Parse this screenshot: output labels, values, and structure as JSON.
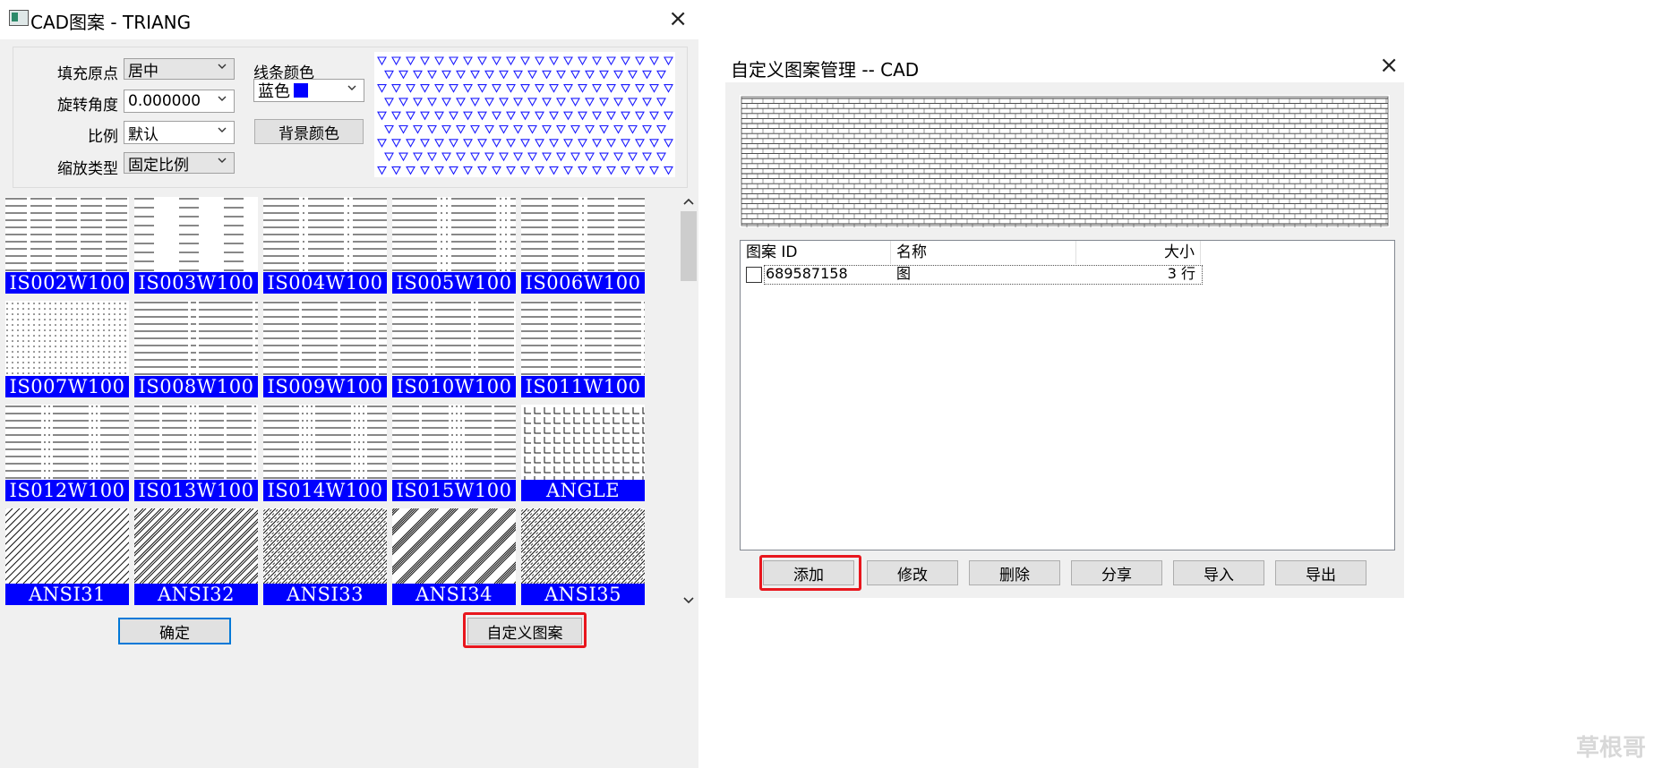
{
  "left_dialog": {
    "title": "CAD图案 - TRIANG",
    "close": "×",
    "fields": {
      "fill_origin_label": "填充原点",
      "fill_origin_value": "居中",
      "rotation_label": "旋转角度",
      "rotation_value": "0.000000",
      "scale_label": "比例",
      "scale_value": "默认",
      "scale_type_label": "缩放类型",
      "scale_type_value": "固定比例",
      "line_color_label": "线条颜色",
      "line_color_value": "蓝色",
      "line_color_swatch": "#0000ff",
      "background_color_button": "背景颜色"
    },
    "patterns": [
      "IS002W100",
      "IS003W100",
      "IS004W100",
      "IS005W100",
      "IS006W100",
      "IS007W100",
      "IS008W100",
      "IS009W100",
      "IS010W100",
      "IS011W100",
      "IS012W100",
      "IS013W100",
      "IS014W100",
      "IS015W100",
      "ANGLE",
      "ANSI31",
      "ANSI32",
      "ANSI33",
      "ANSI34",
      "ANSI35"
    ],
    "ok_button": "确定",
    "custom_pattern_button": "自定义图案"
  },
  "right_dialog": {
    "title": "自定义图案管理 -- CAD",
    "close": "×",
    "table": {
      "columns": [
        "图案 ID",
        "名称",
        "大小"
      ],
      "rows": [
        {
          "id": "689587158",
          "name": "图",
          "size": "3 行"
        }
      ]
    },
    "buttons": {
      "add": "添加",
      "modify": "修改",
      "delete": "删除",
      "share": "分享",
      "import": "导入",
      "export": "导出"
    }
  },
  "watermark": "草根哥",
  "colors": {
    "pattern_label_bg": "#0000ff",
    "highlight_red": "#e8161d",
    "preview_triangles": "#1a1aff"
  }
}
